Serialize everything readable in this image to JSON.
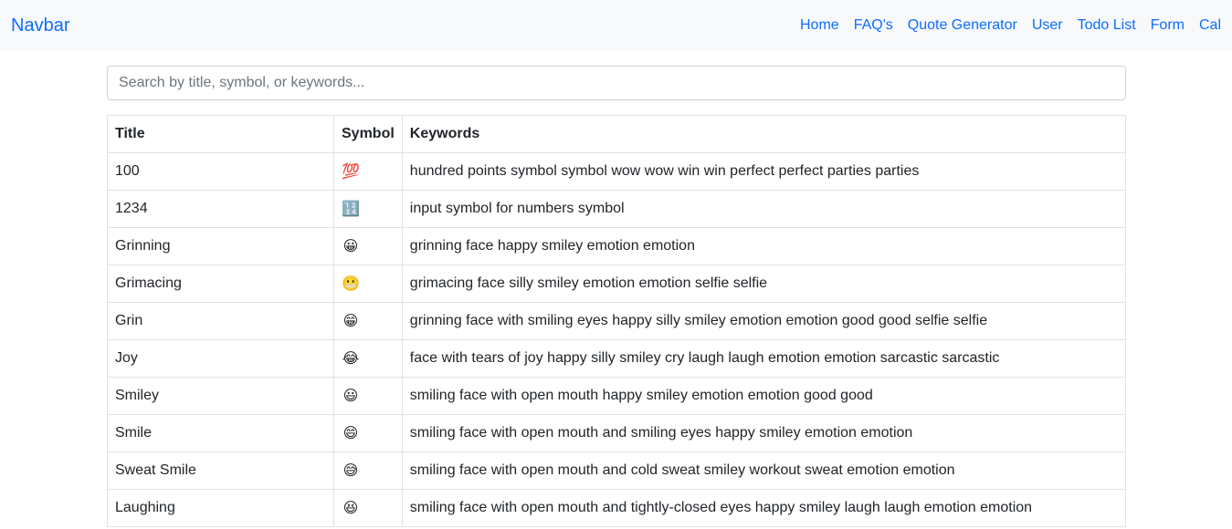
{
  "navbar": {
    "brand": "Navbar",
    "links": [
      "Home",
      "FAQ's",
      "Quote Generator",
      "User",
      "Todo List",
      "Form",
      "Cal"
    ]
  },
  "search": {
    "placeholder": "Search by title, symbol, or keywords..."
  },
  "table": {
    "headers": [
      "Title",
      "Symbol",
      "Keywords"
    ],
    "rows": [
      {
        "title": "100",
        "symbol": "💯",
        "keywords": "hundred points symbol symbol wow wow win win perfect perfect parties parties"
      },
      {
        "title": "1234",
        "symbol": "🔢",
        "keywords": "input symbol for numbers symbol"
      },
      {
        "title": "Grinning",
        "symbol": "😀",
        "keywords": "grinning face happy smiley emotion emotion"
      },
      {
        "title": "Grimacing",
        "symbol": "😬",
        "keywords": "grimacing face silly smiley emotion emotion selfie selfie"
      },
      {
        "title": "Grin",
        "symbol": "😁",
        "keywords": "grinning face with smiling eyes happy silly smiley emotion emotion good good selfie selfie"
      },
      {
        "title": "Joy",
        "symbol": "😂",
        "keywords": "face with tears of joy happy silly smiley cry laugh laugh emotion emotion sarcastic sarcastic"
      },
      {
        "title": "Smiley",
        "symbol": "😃",
        "keywords": "smiling face with open mouth happy smiley emotion emotion good good"
      },
      {
        "title": "Smile",
        "symbol": "😄",
        "keywords": "smiling face with open mouth and smiling eyes happy smiley emotion emotion"
      },
      {
        "title": "Sweat Smile",
        "symbol": "😅",
        "keywords": "smiling face with open mouth and cold sweat smiley workout sweat emotion emotion"
      },
      {
        "title": "Laughing",
        "symbol": "😆",
        "keywords": "smiling face with open mouth and tightly-closed eyes happy smiley laugh laugh emotion emotion"
      }
    ]
  }
}
